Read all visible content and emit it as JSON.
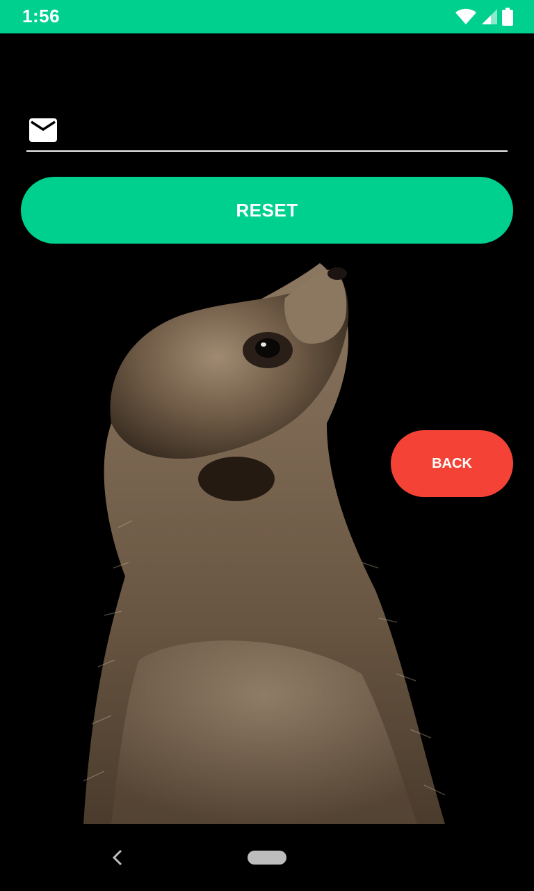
{
  "status_bar": {
    "time": "1:56",
    "background": "#00d08e",
    "icons": [
      "wifi-icon",
      "cell-signal-icon",
      "battery-icon"
    ]
  },
  "form": {
    "email_icon": "mail-icon",
    "email_value": "",
    "reset_label": "RESET",
    "reset_color": "#00d08e"
  },
  "back_button": {
    "label": "BACK",
    "color": "#f44336"
  },
  "background_image": {
    "subject": "meerkat"
  },
  "nav_bar": {
    "icons": [
      "nav-back-icon",
      "nav-home-pill"
    ]
  }
}
